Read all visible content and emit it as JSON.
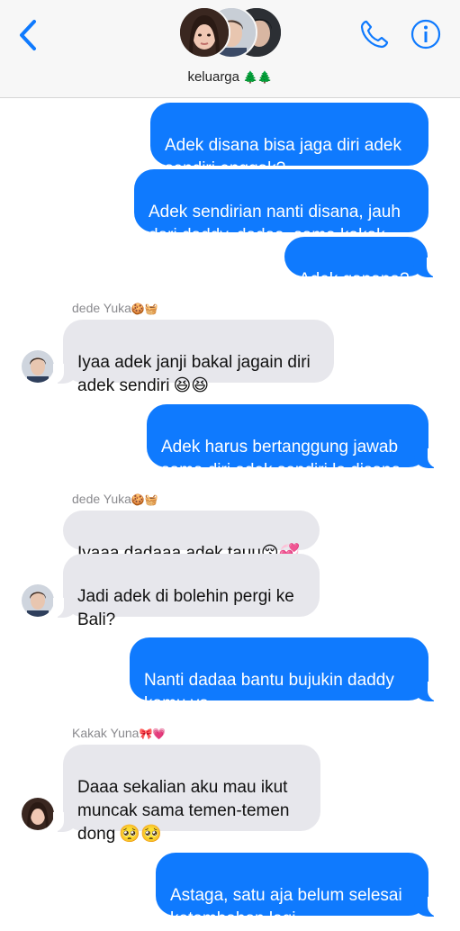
{
  "header": {
    "group_name": "keluarga",
    "group_emoji": "🌲🌲",
    "icons": {
      "back": "chevron-left-icon",
      "call": "phone-icon",
      "info": "info-icon"
    },
    "accent_color": "#0f7afe"
  },
  "messages": [
    {
      "dir": "sent",
      "text": "Adek disana bisa jaga diri adek\nsendiri enggak?"
    },
    {
      "dir": "sent",
      "text": "Adek sendirian nanti disana, jauh\ndari daddy, dadaa, sama kakak"
    },
    {
      "dir": "sent",
      "text": "Adek gapapa?"
    },
    {
      "dir": "recv",
      "sender": "dede Yuka",
      "sender_emoji": "🍪🧺",
      "text": "Iyaa adek janji bakal jagain diri\nadek sendiri",
      "emoji": "😆😆"
    },
    {
      "dir": "sent",
      "text": "Adek harus bertanggung jawab\nsama diri adek sendiri lo disana"
    },
    {
      "dir": "recv",
      "sender": "dede Yuka",
      "sender_emoji": "🍪🧺",
      "text": "Iyaaa dadaaa adek tauu",
      "emoji": "😚💞"
    },
    {
      "dir": "recv",
      "text": "Jadi adek di bolehin pergi ke\nBali?"
    },
    {
      "dir": "sent",
      "text": "Nanti dadaa bantu bujukin daddy\nkamu ya"
    },
    {
      "dir": "recv",
      "sender": "Kakak Yuna",
      "sender_emoji": "🎀💗",
      "text": "Daaa sekalian aku mau ikut\nmuncak sama temen-temen\ndong",
      "emoji": "🥺🥺"
    },
    {
      "dir": "sent",
      "text": "Astaga, satu aja belum selesai\nketambahan lagi"
    }
  ]
}
